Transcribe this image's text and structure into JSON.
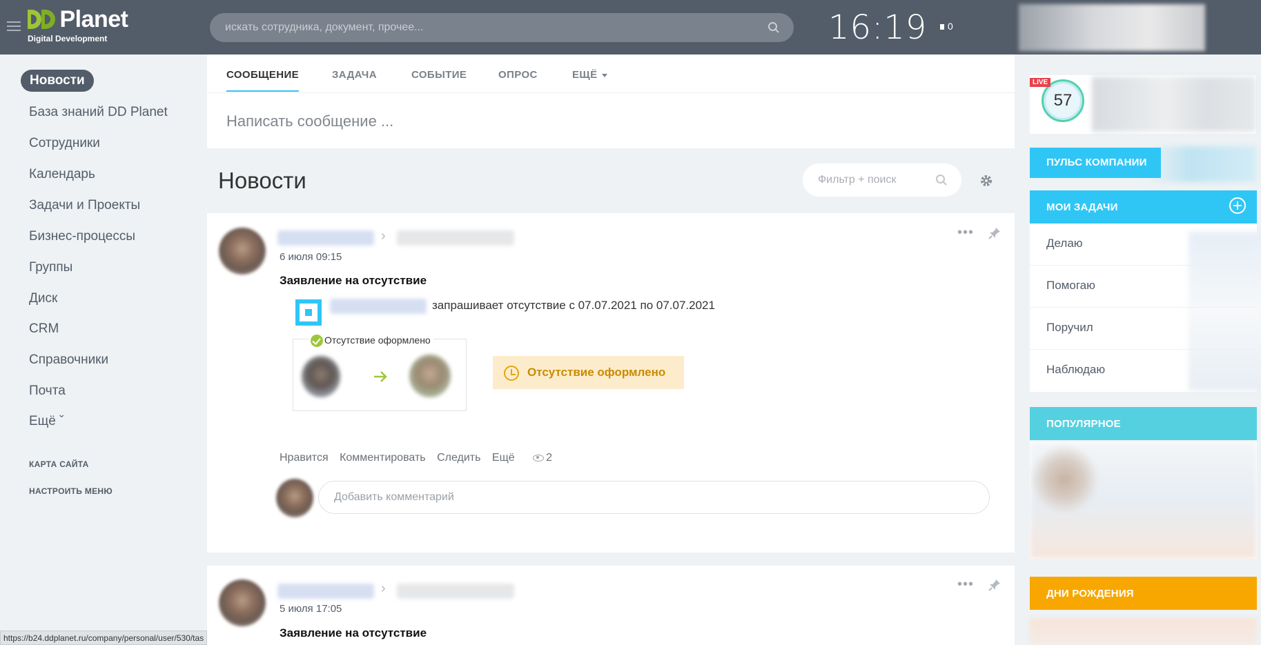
{
  "header": {
    "logo_word": "Planet",
    "logo_mark": "DD",
    "logo_sub": "Digital Development",
    "search_placeholder": "искать сотрудника, документ, прочее...",
    "time": "16:19",
    "flag_count": "0"
  },
  "left_menu": {
    "items": [
      "Новости",
      "База знаний DD Planet",
      "Сотрудники",
      "Календарь",
      "Задачи и Проекты",
      "Бизнес-процессы",
      "Группы",
      "Диск",
      "CRM",
      "Справочники",
      "Почта",
      "Ещё ˇ"
    ],
    "active_index": 0,
    "sitemap": "КАРТА САЙТА",
    "configure": "НАСТРОИТЬ МЕНЮ"
  },
  "status_url": "https://b24.ddplanet.ru/company/personal/user/530/tas",
  "composer": {
    "tabs": [
      "СООБЩЕНИЕ",
      "ЗАДАЧА",
      "СОБЫТИЕ",
      "ОПРОС",
      "ЕЩЁ"
    ],
    "placeholder": "Написать сообщение ..."
  },
  "feed": {
    "title": "Новости",
    "filter_placeholder": "Фильтр + поиск"
  },
  "posts": [
    {
      "date": "6 июля 09:15",
      "title": "Заявление на отсутствие",
      "request_text": "запрашивает отсутствие с 07.07.2021 по 07.07.2021",
      "absence_label": "Отсутствие оформлено",
      "status": "Отсутствие оформлено",
      "actions": [
        "Нравится",
        "Комментировать",
        "Следить",
        "Ещё"
      ],
      "views": "2",
      "comment_placeholder": "Добавить комментарий"
    },
    {
      "date": "5 июля 17:05",
      "title": "Заявление на отсутствие"
    }
  ],
  "right": {
    "live_badge": "LIVE",
    "live_count": "57",
    "pulse": "ПУЛЬС КОМПАНИИ",
    "my_tasks": "МОИ ЗАДАЧИ",
    "task_items": [
      "Делаю",
      "Помогаю",
      "Поручил",
      "Наблюдаю"
    ],
    "popular": "ПОПУЛЯРНОЕ",
    "birthdays": "ДНИ РОЖДЕНИЯ"
  },
  "colors": {
    "header": "#535c69",
    "accent": "#2fc6f6",
    "popular": "#55d0e0",
    "birthdays": "#f7a700",
    "status_bg": "#fdeccb",
    "status_text": "#c98b00",
    "live": "#e8414a"
  }
}
